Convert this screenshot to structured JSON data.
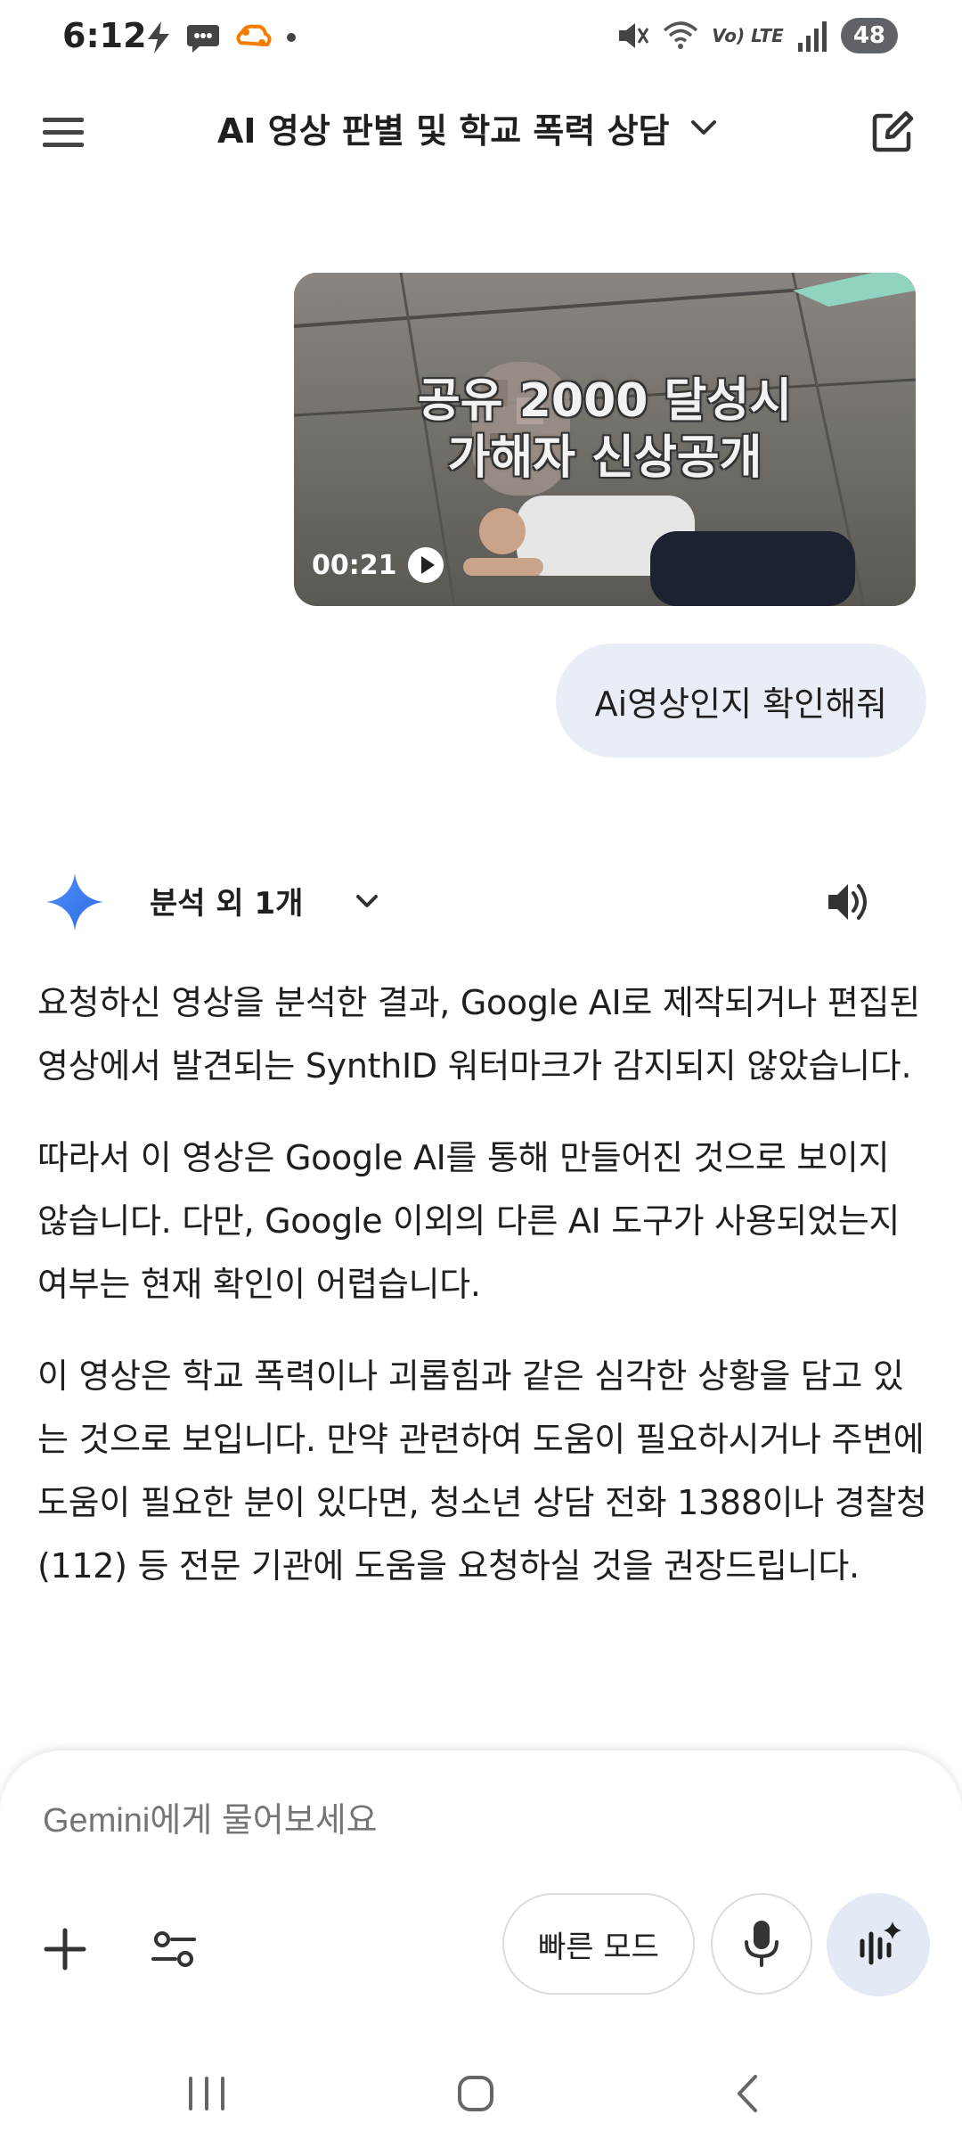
{
  "status_bar": {
    "time": "6:12",
    "battery": "48",
    "network_label": "Vo) LTE",
    "left_icons": [
      "bolt-icon",
      "chat-bubble-icon",
      "cloud-sync-icon",
      "dot-icon"
    ],
    "right_icons": [
      "mute-icon",
      "wifi-icon",
      "lte-icon",
      "signal-icon",
      "battery-icon"
    ]
  },
  "app_bar": {
    "title": "AI 영상 판별 및 학교 폭력 상담",
    "menu_icon": "hamburger-menu-icon",
    "edit_icon": "new-chat-edit-icon"
  },
  "video": {
    "caption_line1": "공유 2000 달성시",
    "caption_line2": "가해자 신상공개",
    "duration": "00:21"
  },
  "user_message": "Ai영상인지 확인해줘",
  "response": {
    "header_label": "분석 외 1개",
    "paragraphs": [
      "요청하신 영상을 분석한 결과, Google AI로 제작되거나 편집된 영상에서 발견되는 SynthID 워터마크가 감지되지 않았습니다.",
      "따라서 이 영상은 Google AI를 통해 만들어진 것으로 보이지 않습니다. 다만, Google 이외의 다른 AI 도구가 사용되었는지 여부는 현재 확인이 어렵습니다.",
      "이 영상은 학교 폭력이나 괴롭힘과 같은 심각한 상황을 담고 있는 것으로 보입니다. 만약 관련하여 도움이 필요하시거나 주변에 도움이 필요한 분이 있다면, 청소년 상담 전화 1388이나 경찰청(112) 등 전문 기관에 도움을 요청하실 것을 권장드립니다."
    ]
  },
  "composer": {
    "placeholder": "Gemini에게 물어보세요",
    "mode_label": "빠른 모드"
  },
  "colors": {
    "user_bubble": "#e9eef6",
    "live_button": "#e3e9f5",
    "gemini_blue": "#4285f4"
  }
}
